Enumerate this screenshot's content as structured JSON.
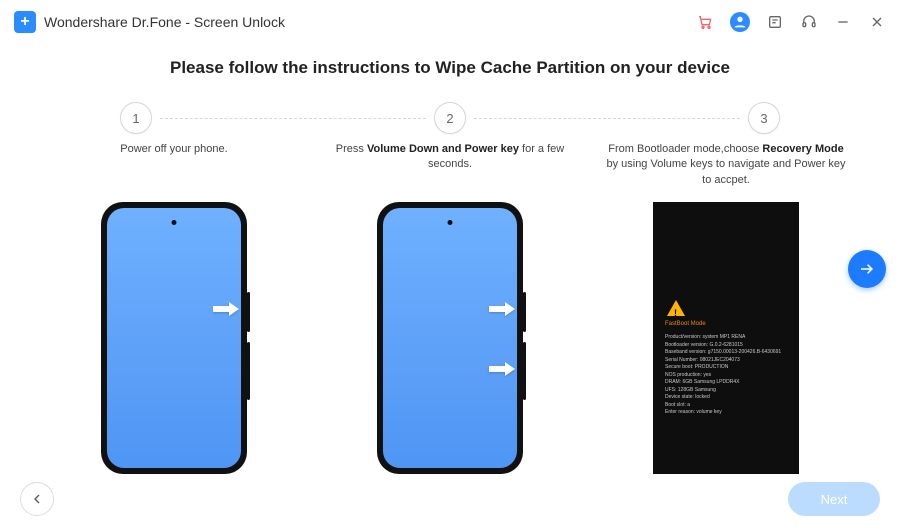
{
  "app": {
    "title": "Wondershare Dr.Fone - Screen Unlock"
  },
  "heading": "Please follow the instructions to Wipe Cache Partition on your device",
  "steps": {
    "n1": "1",
    "n2": "2",
    "n3": "3",
    "cap1_text": "Power off your phone.",
    "cap2_prefix": "Press ",
    "cap2_bold": "Volume Down and Power key",
    "cap2_suffix": " for a few seconds.",
    "cap3_prefix": "From Bootloader mode,choose ",
    "cap3_bold": "Recovery Mode",
    "cap3_suffix": " by using Volume keys to navigate and Power key to accpet."
  },
  "bootloader": {
    "fastboot": "FastBoot Mode",
    "lines": "Product/version: system MP1 RENA\nBootloader version: G.0.2-6281015\nBaseband version: g7150.00013-200426.B-6430691\nSerial Number: 08021JEC204073\nSecure boot: PRODUCTION\nNOS production: yes\nDRAM: 6GB Samsung LPDDR4X\nUFS: 128GB Samsung\nDevice state: locked\nBoot slot: a\nEnter reason: volume key"
  },
  "buttons": {
    "next": "Next"
  }
}
